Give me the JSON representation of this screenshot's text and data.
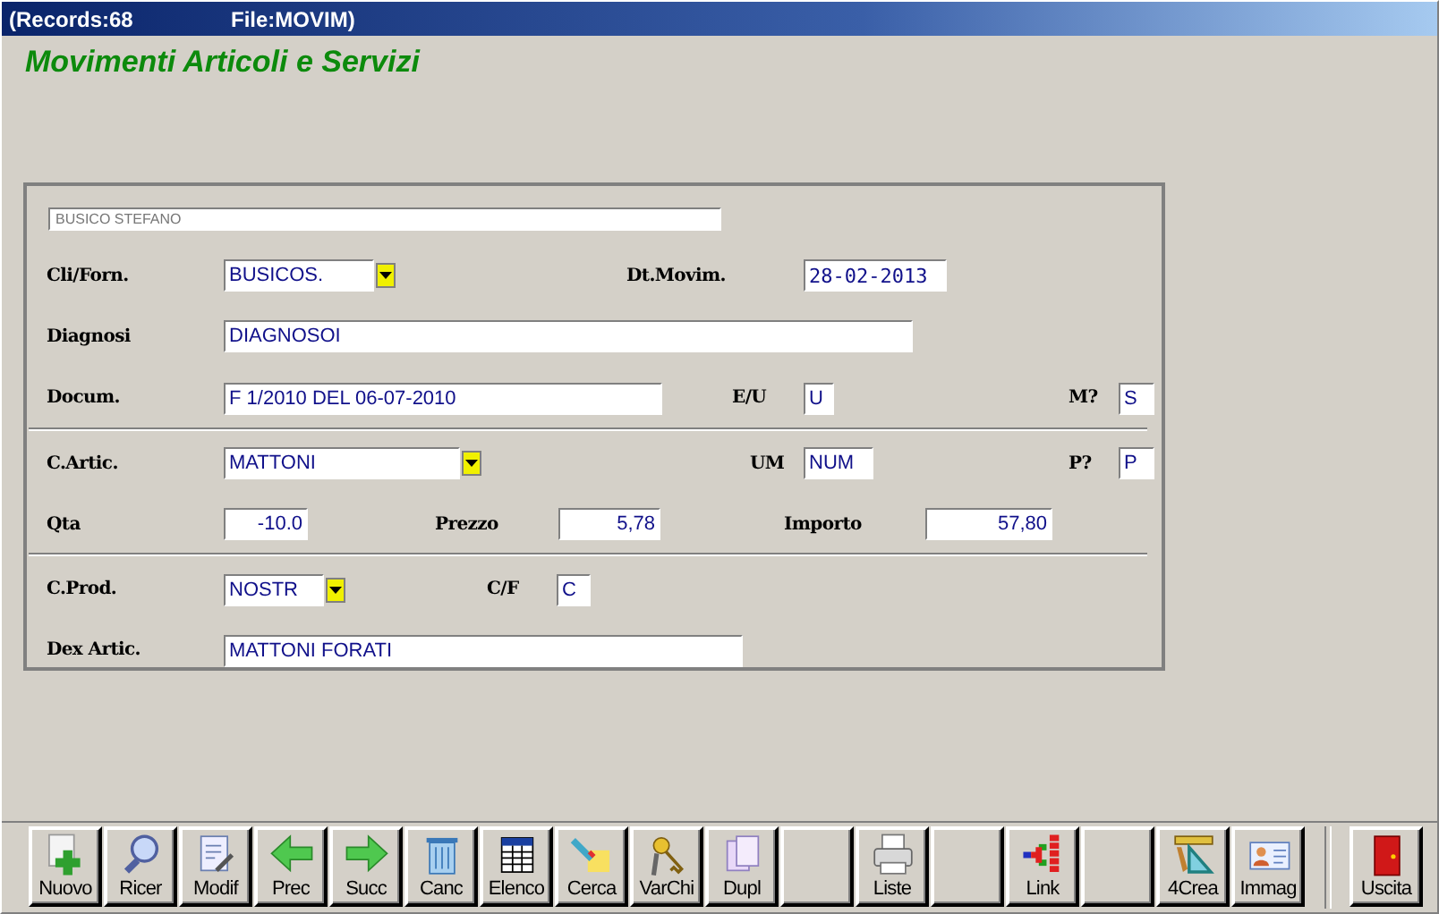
{
  "title_bar": {
    "records": "(Records:68",
    "file": "File:MOVIM)"
  },
  "heading": "Movimenti Articoli e Servizi",
  "form": {
    "header_field": "BUSICO STEFANO",
    "rows": [
      {
        "items": [
          {
            "kind": "label",
            "text": "Cli/Forn."
          },
          {
            "kind": "combo",
            "value": "BUSICOS."
          },
          {
            "kind": "label",
            "text": "Dt.Movim."
          },
          {
            "kind": "field",
            "value": "28-02-2013",
            "mono": true
          }
        ]
      },
      {
        "items": [
          {
            "kind": "label",
            "text": "Diagnosi"
          },
          {
            "kind": "field",
            "value": "DIAGNOSOI"
          }
        ]
      },
      {
        "items": [
          {
            "kind": "label",
            "text": "Docum."
          },
          {
            "kind": "field",
            "value": "F 1/2010 DEL 06-07-2010"
          },
          {
            "kind": "label",
            "text": "E/U"
          },
          {
            "kind": "field",
            "value": "U"
          },
          {
            "kind": "label",
            "text": "M?"
          },
          {
            "kind": "field",
            "value": "S"
          }
        ],
        "separator_after": true
      },
      {
        "items": [
          {
            "kind": "label",
            "text": "C.Artic."
          },
          {
            "kind": "combo",
            "value": "MATTONI"
          },
          {
            "kind": "label",
            "text": "UM"
          },
          {
            "kind": "field",
            "value": "NUM"
          },
          {
            "kind": "label",
            "text": "P?"
          },
          {
            "kind": "field",
            "value": "P"
          }
        ]
      },
      {
        "items": [
          {
            "kind": "label",
            "text": "Qta"
          },
          {
            "kind": "number",
            "value": "-10.0"
          },
          {
            "kind": "label",
            "text": "Prezzo"
          },
          {
            "kind": "number",
            "value": "5,78"
          },
          {
            "kind": "label",
            "text": "Importo"
          },
          {
            "kind": "number",
            "value": "57,80"
          }
        ],
        "separator_after": true
      },
      {
        "items": [
          {
            "kind": "label",
            "text": "C.Prod."
          },
          {
            "kind": "combo",
            "value": "NOSTR"
          },
          {
            "kind": "label",
            "text": "C/F"
          },
          {
            "kind": "field",
            "value": "C"
          }
        ]
      },
      {
        "items": [
          {
            "kind": "label",
            "text": "Dex Artic."
          },
          {
            "kind": "field",
            "value": "MATTONI FORATI"
          }
        ]
      }
    ]
  },
  "toolbar": [
    {
      "kind": "action",
      "label": "Nuovo"
    },
    {
      "kind": "action",
      "label": "Ricer"
    },
    {
      "kind": "action",
      "label": "Modif"
    },
    {
      "kind": "action",
      "label": "Prec"
    },
    {
      "kind": "action",
      "label": "Succ"
    },
    {
      "kind": "action",
      "label": "Canc"
    },
    {
      "kind": "action",
      "label": "Elenco"
    },
    {
      "kind": "action",
      "label": "Cerca"
    },
    {
      "kind": "action",
      "label": "VarChi"
    },
    {
      "kind": "action",
      "label": "Dupl"
    },
    {
      "kind": "blank"
    },
    {
      "kind": "action",
      "label": "Liste"
    },
    {
      "kind": "blank"
    },
    {
      "kind": "action",
      "label": "Link"
    },
    {
      "kind": "blank"
    },
    {
      "kind": "action",
      "label": "4Crea"
    },
    {
      "kind": "action",
      "label": "Immag"
    },
    {
      "kind": "exit",
      "label": "Uscita"
    }
  ]
}
